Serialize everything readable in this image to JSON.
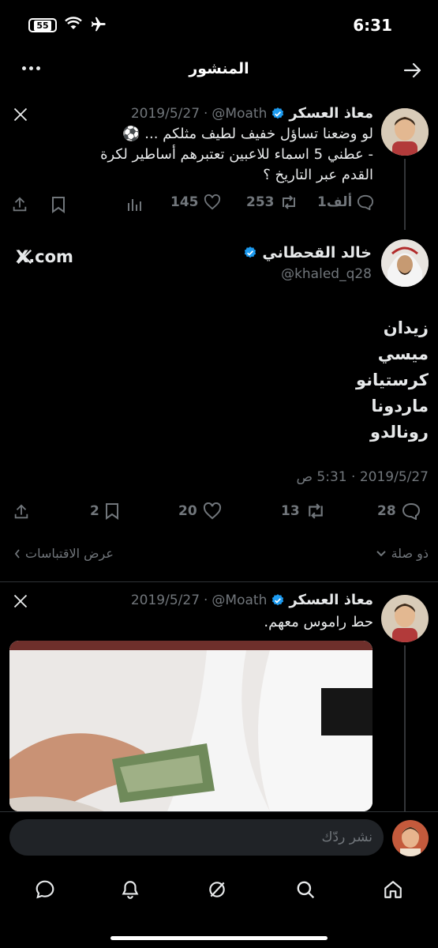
{
  "status_bar": {
    "time": "6:31",
    "battery": "55"
  },
  "header": {
    "title": "المنشور"
  },
  "quoted_tweet_1": {
    "name": "معاذ العسكر",
    "handle": "@Moath",
    "date": "2019/5/27",
    "text_line1": "لو وضعنا تساؤل خفيف لطيف مثلكم ... ⚽",
    "text_line2": "- عطني 5 اسماء للاعبين تعتبرهم أساطير لكرة",
    "text_line3": "القدم عبر التاريخ ؟",
    "replies": "1ألف",
    "retweets": "253",
    "likes": "145"
  },
  "main_tweet": {
    "name": "خالد القحطاني",
    "handle": "@khaled_q28",
    "source_badge": "X.com",
    "lines": [
      "زيدان",
      "ميسي",
      "كرستيانو",
      "ماردونا",
      "رونالدو"
    ],
    "timestamp": "2019/5/27 · 5:31 ص",
    "replies": "28",
    "retweets": "13",
    "likes": "20",
    "bookmarks": "2"
  },
  "links": {
    "related": "ذو صلة",
    "quotes": "عرض الاقتباسات"
  },
  "quoted_tweet_2": {
    "name": "معاذ العسكر",
    "handle": "@Moath",
    "date": "2019/5/27",
    "text": "حط راموس معهم."
  },
  "reply_box": {
    "placeholder": "نشر ردّك"
  }
}
